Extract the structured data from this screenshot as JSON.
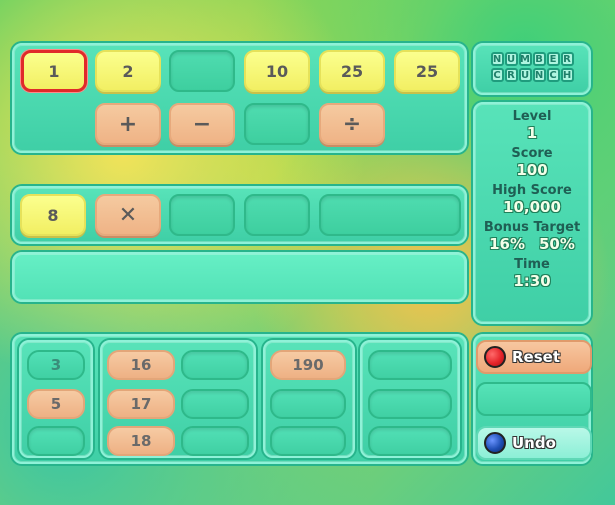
{
  "logo": {
    "line1": [
      "N",
      "U",
      "M",
      "B",
      "E",
      "R"
    ],
    "line2": [
      "C",
      "R",
      "U",
      "N",
      "C",
      "H"
    ]
  },
  "source_numbers": [
    "1",
    "2",
    "",
    "10",
    "25",
    "25"
  ],
  "selected_index": 0,
  "operators": [
    {
      "label": "+",
      "icon": "plus-icon"
    },
    {
      "label": "−",
      "icon": "minus-icon"
    },
    {
      "label": "",
      "icon": ""
    },
    {
      "label": "÷",
      "icon": "divide-icon"
    }
  ],
  "equation": [
    {
      "label": "8",
      "kind": "num"
    },
    {
      "label": "✕",
      "kind": "op",
      "icon": "multiply-icon"
    },
    {
      "label": "",
      "kind": "empty"
    },
    {
      "label": "",
      "kind": "empty"
    },
    {
      "label": "",
      "kind": "empty"
    }
  ],
  "result_text": "",
  "stats": {
    "level_label": "Level",
    "level": "1",
    "score_label": "Score",
    "score": "100",
    "high_label": "High Score",
    "high": "10,000",
    "bonus_label": "Bonus Target",
    "bonus_1": "16%",
    "bonus_2": "50%",
    "time_label": "Time",
    "time": "1:30"
  },
  "targets": {
    "col1": [
      "3",
      "5",
      ""
    ],
    "col2a": [
      "16",
      "17",
      "18"
    ],
    "col2b": [
      "",
      "",
      ""
    ],
    "col3a": [
      "190",
      "",
      ""
    ],
    "col3b": [
      "",
      "",
      ""
    ],
    "col4": [
      "",
      "",
      ""
    ]
  },
  "buttons": {
    "reset": "Reset",
    "undo": "Undo"
  },
  "colors": {
    "reset": "#e5242a",
    "undo": "#1f4fb5",
    "selected": "#e02a2a"
  }
}
